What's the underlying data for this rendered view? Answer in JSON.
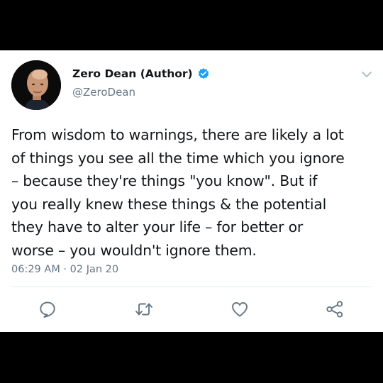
{
  "tweet": {
    "display_name": "Zero Dean (Author)",
    "handle": "@ZeroDean",
    "text": "From wisdom to warnings, there are likely a lot\nof things you see all the time which you ignore\n– because they're things \"you know\". But if\nyou really knew these things & the potential\nthey have to alter your life – for better or\nworse – you wouldn't ignore them.",
    "timestamp": "06:29 AM · 02 Jan 20",
    "verified": true
  },
  "icons": {
    "verified": "verified-badge-icon",
    "menu": "chevron-down-icon",
    "reply": "reply-icon",
    "retweet": "retweet-icon",
    "like": "heart-icon",
    "share": "share-icon"
  },
  "colors": {
    "background": "#000000",
    "card": "#ffffff",
    "text": "#14171a",
    "secondary_text": "#657786",
    "verified_blue": "#1da1f2",
    "action_icon": "#657786",
    "divider": "#e6ecf0"
  }
}
